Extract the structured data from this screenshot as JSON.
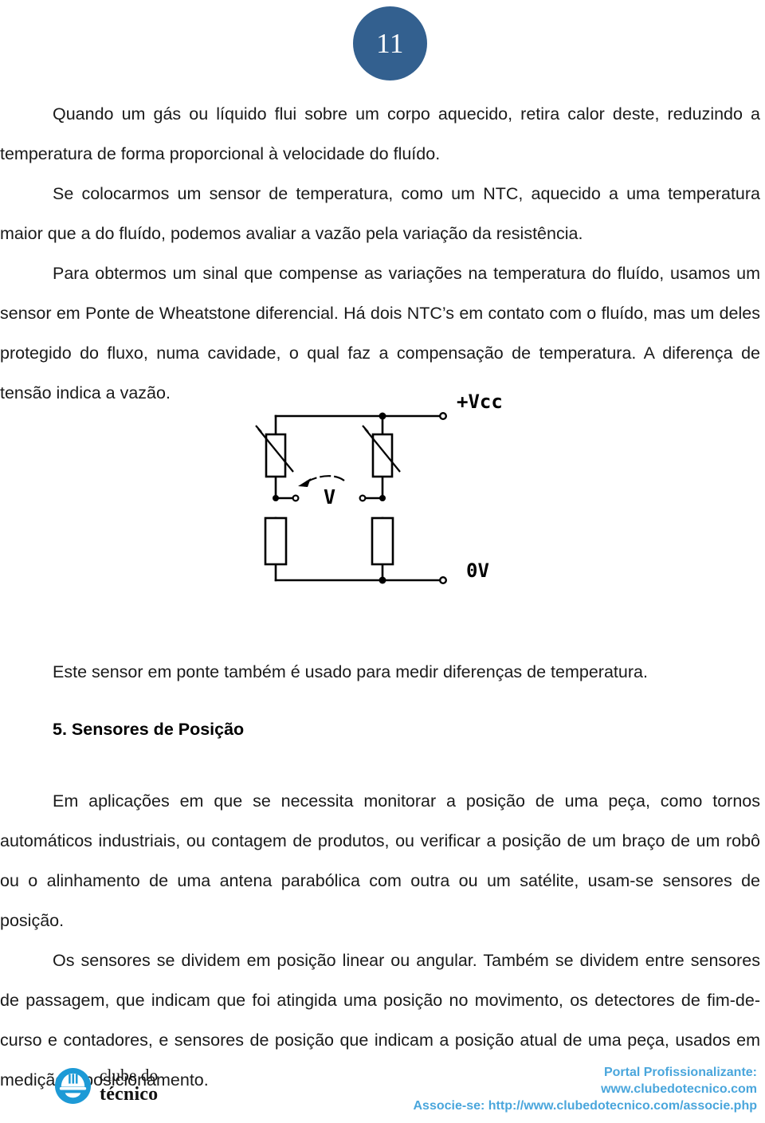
{
  "page": {
    "number": "11"
  },
  "body": {
    "paragraphs": [
      "Quando um gás ou líquido flui sobre um corpo aquecido, retira calor deste, reduzindo a temperatura de forma proporcional à velocidade do fluído.",
      "Se colocarmos um sensor de temperatura, como um NTC, aquecido a uma temperatura maior que a do fluído, podemos avaliar a vazão pela variação da resistência.",
      "Para obtermos um sinal que compense as variações na temperatura do fluído, usamos um sensor em Ponte de Wheatstone diferencial. Há dois NTC’s em contato com o fluído, mas um deles protegido do fluxo, numa cavidade, o qual faz a compensação de temperatura. A diferença de tensão indica a vazão."
    ],
    "caption": "Este sensor em ponte também é usado para medir diferenças de temperatura.",
    "section_heading": "5. Sensores de Posição",
    "paragraphs_after": [
      "Em aplicações em que se necessita monitorar a posição de uma peça, como tornos automáticos industriais, ou contagem de produtos, ou verificar a posição de um braço de um robô ou o alinhamento de uma antena parabólica com outra ou um satélite, usam-se sensores de posição.",
      "Os sensores se dividem em posição linear ou angular. Também se dividem entre sensores de passagem, que indicam que foi atingida uma posição no movimento, os detectores de fim-de-curso e contadores, e sensores de posição que indicam a posição atual de uma peça, usados em medição e posicionamento."
    ]
  },
  "figure": {
    "name": "wheatstone-bridge-ntc-circuit",
    "labels": {
      "supply": "+Vcc",
      "ground": "0V",
      "measure": "V"
    }
  },
  "footer": {
    "logo": {
      "line1": "clube do",
      "line2": "técnico"
    },
    "links": {
      "line1": "Portal Profissionalizante:",
      "line2": "www.clubedotecnico.com",
      "line3": "Associe-se: http://www.clubedotecnico.com/associe.php"
    }
  },
  "colors": {
    "badge": "#33608f",
    "footer_link": "#4aa6dc",
    "logo_blue": "#1d9ad6"
  }
}
